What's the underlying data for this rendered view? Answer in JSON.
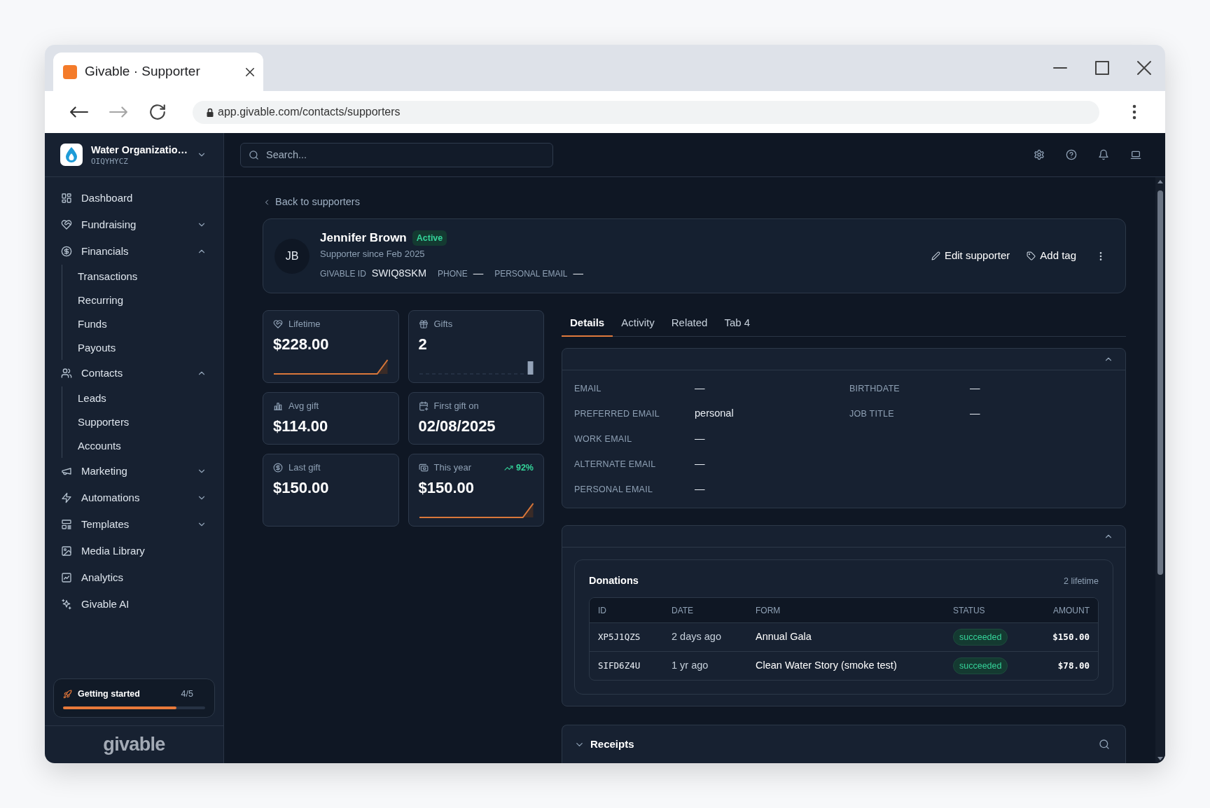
{
  "browser": {
    "tab_title": "Givable · Supporter",
    "url": "app.givable.com/contacts/supporters",
    "forward_disabled": true
  },
  "org": {
    "name": "Water Organizatio…",
    "code": "OIQYHYCZ"
  },
  "sidebar": {
    "items": [
      {
        "kind": "link",
        "label": "Dashboard"
      },
      {
        "kind": "group",
        "label": "Fundraising",
        "expanded": false
      },
      {
        "kind": "group",
        "label": "Financials",
        "expanded": true,
        "children": [
          {
            "label": "Transactions"
          },
          {
            "label": "Recurring"
          },
          {
            "label": "Funds"
          },
          {
            "label": "Payouts"
          }
        ]
      },
      {
        "kind": "group",
        "label": "Contacts",
        "expanded": true,
        "children": [
          {
            "label": "Leads"
          },
          {
            "label": "Supporters"
          },
          {
            "label": "Accounts"
          }
        ]
      },
      {
        "kind": "group",
        "label": "Marketing",
        "expanded": false
      },
      {
        "kind": "group",
        "label": "Automations",
        "expanded": false
      },
      {
        "kind": "group",
        "label": "Templates",
        "expanded": false
      },
      {
        "kind": "link",
        "label": "Media Library"
      },
      {
        "kind": "link",
        "label": "Analytics"
      },
      {
        "kind": "link",
        "label": "Givable AI"
      }
    ],
    "getting_started": {
      "label": "Getting started",
      "count": "4/5",
      "level": 0.8
    },
    "footer_logo": "givable"
  },
  "header": {
    "search": {
      "placeholder": "Search..."
    }
  },
  "back_link": "Back to supporters",
  "profile": {
    "initials": "JB",
    "name": "Jennifer Brown",
    "status": "Active",
    "since": "Supporter since Feb 2025",
    "fields": [
      {
        "label": "GIVABLE ID",
        "value": "SWIQ8SKM"
      },
      {
        "label": "PHONE",
        "value": "—"
      },
      {
        "label": "PERSONAL EMAIL",
        "value": "—"
      }
    ],
    "actions": [
      "Edit supporter",
      "Add tag"
    ]
  },
  "stats": [
    {
      "label": "Lifetime",
      "value": "$228.00",
      "kind": "line"
    },
    {
      "label": "Gifts",
      "value": "2",
      "kind": "bars"
    },
    {
      "label": "Avg gift",
      "value": "$114.00",
      "kind": "plain"
    },
    {
      "label": "First gift on",
      "value": "02/08/2025",
      "kind": "plain"
    },
    {
      "label": "Last gift",
      "value": "$150.00",
      "kind": "plain"
    },
    {
      "label": "This year",
      "value": "$150.00",
      "kind": "line",
      "trend": "92%"
    }
  ],
  "tabs": [
    {
      "label": "Details",
      "selected": true
    },
    {
      "label": "Activity",
      "selected": false
    },
    {
      "label": "Related",
      "selected": false
    },
    {
      "label": "Tab 4",
      "selected": false
    }
  ],
  "sections": [
    {
      "kind": "fields",
      "expanded": true,
      "columns": [
        {
          "fields": [
            {
              "label": "EMAIL",
              "value": "—"
            },
            {
              "label": "PREFERRED EMAIL",
              "value": "personal"
            },
            {
              "label": "WORK EMAIL",
              "value": "—"
            },
            {
              "label": "ALTERNATE EMAIL",
              "value": "—"
            },
            {
              "label": "PERSONAL EMAIL",
              "value": "—"
            }
          ]
        },
        {
          "fields": [
            {
              "label": "BIRTHDATE",
              "value": "—"
            },
            {
              "label": "JOB TITLE",
              "value": "—"
            }
          ]
        }
      ]
    },
    {
      "kind": "table",
      "expanded": true,
      "title": "Donations",
      "count": "2 lifetime",
      "columns": [
        "ID",
        "DATE",
        "FORM",
        "STATUS",
        "AMOUNT"
      ],
      "rows": [
        {
          "id": "XP5J1QZS",
          "date": "2 days ago",
          "form": "Annual Gala",
          "status": "succeeded",
          "amount": "$150.00"
        },
        {
          "id": "SIFD6Z4U",
          "date": "1 yr ago",
          "form": "Clean Water Story (smoke test)",
          "status": "succeeded",
          "amount": "$78.00"
        }
      ]
    },
    {
      "kind": "titled",
      "expanded": false,
      "title": "Receipts"
    }
  ]
}
